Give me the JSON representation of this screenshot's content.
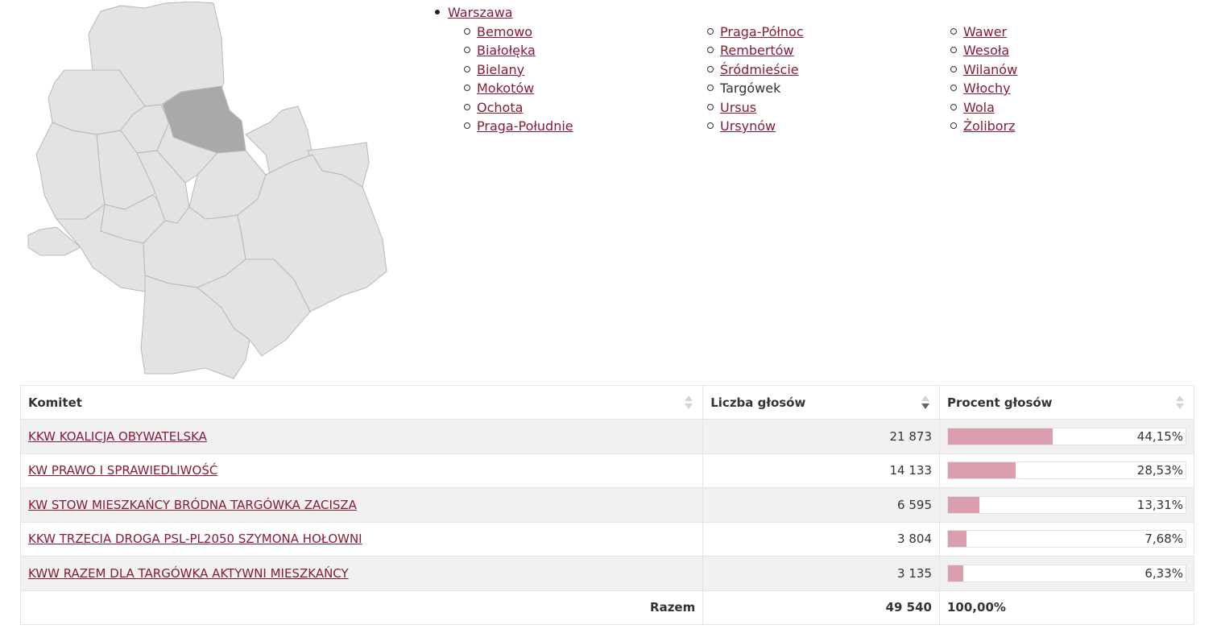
{
  "map": {
    "highlighted_district": "Targówek",
    "colors": {
      "fill": "#e3e3e3",
      "stroke": "#b8b8b8",
      "highlight": "#a9a9a9"
    }
  },
  "nav": {
    "root": "Warszawa",
    "columns": [
      [
        {
          "label": "Bemowo",
          "link": true
        },
        {
          "label": "Białołęka",
          "link": true
        },
        {
          "label": "Bielany",
          "link": true
        },
        {
          "label": "Mokotów",
          "link": true
        },
        {
          "label": "Ochota",
          "link": true
        },
        {
          "label": "Praga-Południe",
          "link": true
        }
      ],
      [
        {
          "label": "Praga-Północ",
          "link": true
        },
        {
          "label": "Rembertów",
          "link": true
        },
        {
          "label": "Śródmieście",
          "link": true
        },
        {
          "label": "Targówek",
          "link": false
        },
        {
          "label": "Ursus",
          "link": true
        },
        {
          "label": "Ursynów",
          "link": true
        }
      ],
      [
        {
          "label": "Wawer",
          "link": true
        },
        {
          "label": "Wesoła",
          "link": true
        },
        {
          "label": "Wilanów",
          "link": true
        },
        {
          "label": "Włochy",
          "link": true
        },
        {
          "label": "Wola",
          "link": true
        },
        {
          "label": "Żoliborz",
          "link": true
        }
      ]
    ]
  },
  "table": {
    "headers": {
      "committee": "Komitet",
      "votes": "Liczba głosów",
      "percent": "Procent głosów"
    },
    "sort": {
      "column": "votes",
      "direction": "desc"
    },
    "rows": [
      {
        "committee": "KKW KOALICJA OBYWATELSKA",
        "votes": "21 873",
        "percent": "44,15%",
        "share": 0.4415
      },
      {
        "committee": "KW PRAWO I SPRAWIEDLIWOŚĆ",
        "votes": "14 133",
        "percent": "28,53%",
        "share": 0.2853
      },
      {
        "committee": "KW STOW MIESZKAŃCY BRÓDNA TARGÓWKA ZACISZA",
        "votes": "6 595",
        "percent": "13,31%",
        "share": 0.1331
      },
      {
        "committee": "KKW TRZECIA DROGA PSL-PL2050 SZYMONA HOŁOWNI",
        "votes": "3 804",
        "percent": "7,68%",
        "share": 0.0768
      },
      {
        "committee": "KWW RAZEM DLA TARGÓWKA AKTYWNI MIESZKAŃCY",
        "votes": "3 135",
        "percent": "6,33%",
        "share": 0.0633
      }
    ],
    "total": {
      "label": "Razem",
      "votes": "49 540",
      "percent": "100,00%"
    },
    "bar_color": "#d99fae",
    "link_color": "#8a1b33"
  }
}
